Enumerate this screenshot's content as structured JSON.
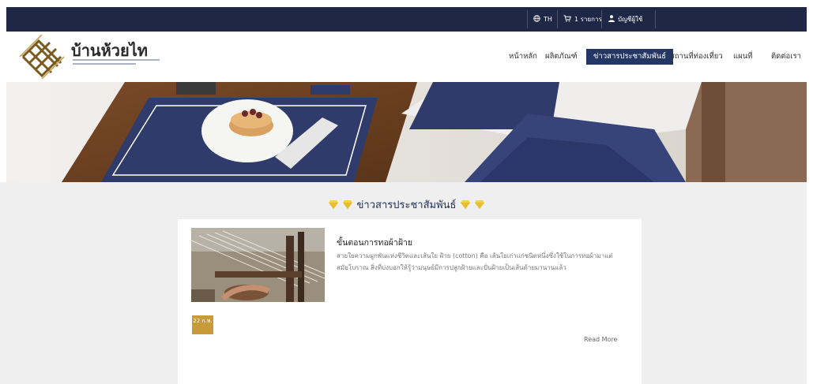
{
  "topbar": {
    "language_label": "TH",
    "cart_label": "1 รายการ",
    "account_label": "บัญชีผู้ใช้"
  },
  "brand": {
    "title": "บ้านห้วยไท"
  },
  "nav": {
    "items": [
      {
        "label": "หน้าหลัก"
      },
      {
        "label": "ผลิตภัณฑ์"
      },
      {
        "label": "ข่าวสารประชาสัมพันธ์"
      },
      {
        "label": "สถานที่ท่องเที่ยว"
      },
      {
        "label": "แผนที่"
      },
      {
        "label": "ติดต่อเรา"
      }
    ],
    "active_index": 2
  },
  "section": {
    "title": "ข่าวสารประชาสัมพันธ์"
  },
  "post": {
    "title": "ขั้นตอนการทอผ้าฝ้าย",
    "excerpt": "สายใยความผูกพันแห่งชีวิตและเส้นใย ฝ้าย (cotton) คือ เส้นใยเก่าแก่ชนิดหนึ่งซึ่งใช้ในการทอผ้ามาแต่สมัยโบราณ สิ่งที่บ่งบอกให้รู้ว่ามนุษย์มีการปลูกฝ้ายและปั่นฝ้ายเป็นเส้นด้ายมานานแล้ว",
    "date": "22 ก.พ.",
    "read_more": "Read More"
  },
  "colors": {
    "topbar": "#1f2747",
    "nav_active": "#243664",
    "accent_gold": "#c79a3a",
    "gem": "#f2d24a"
  }
}
